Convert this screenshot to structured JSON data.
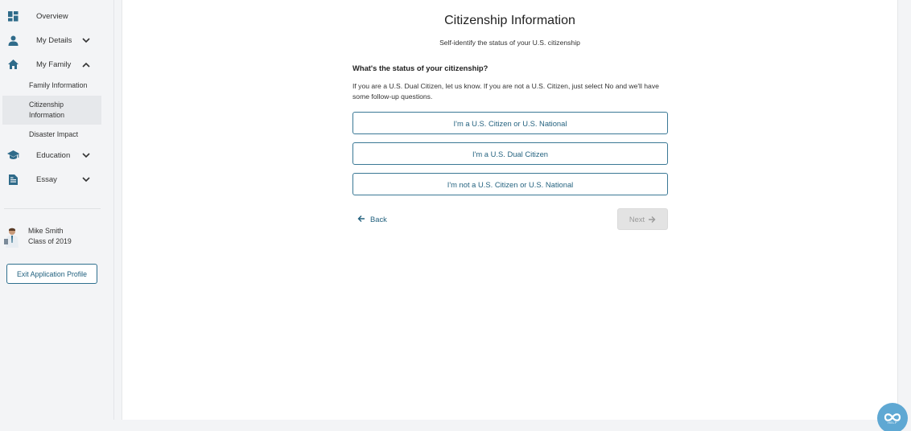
{
  "sidebar": {
    "items": [
      {
        "label": "Overview",
        "icon": "dashboard-icon"
      },
      {
        "label": "My Details",
        "icon": "person-icon",
        "expanded": false
      },
      {
        "label": "My Family",
        "icon": "home-icon",
        "expanded": true
      },
      {
        "label": "Education",
        "icon": "graduation-cap-icon",
        "expanded": false
      },
      {
        "label": "Essay",
        "icon": "document-icon",
        "expanded": false
      }
    ],
    "family_subitems": [
      {
        "label": "Family Information",
        "active": false
      },
      {
        "label": "Citizenship Information",
        "active": true
      },
      {
        "label": "Disaster Impact",
        "active": false
      }
    ],
    "profile": {
      "name": "Mike Smith",
      "class": "Class of 2019"
    },
    "exit_label": "Exit Application Profile"
  },
  "main": {
    "title": "Citizenship Information",
    "subtitle": "Self-identify the status of your U.S. citizenship",
    "question": "What's the status of your citizenship?",
    "help_text": "If you are a U.S. Dual Citizen, let us know. If you are not a U.S. Citizen, just select No and we'll have some follow-up questions.",
    "options": [
      "I'm a U.S. Citizen or U.S. National",
      "I'm a U.S. Dual Citizen",
      "I'm not a U.S. Citizen or U.S. National"
    ],
    "back_label": "Back",
    "next_label": "Next"
  },
  "help_widget": {
    "label": "HELP"
  },
  "colors": {
    "accent": "#24627f",
    "help_bubble": "#5fa8d3",
    "disabled_bg": "#e3e3e3"
  }
}
